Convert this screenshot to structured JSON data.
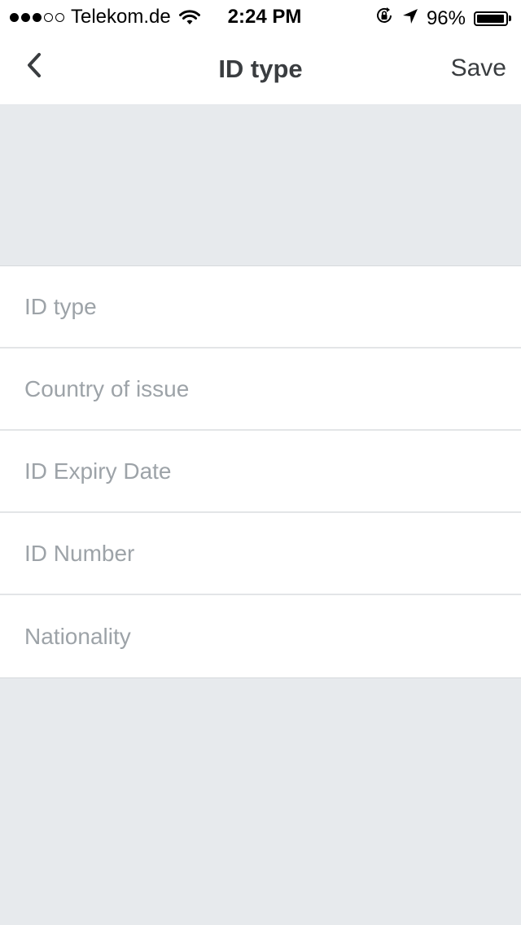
{
  "status_bar": {
    "carrier": "Telekom.de",
    "signal_bars_filled": 3,
    "signal_bars_total": 5,
    "time": "2:24 PM",
    "battery_percent": "96%",
    "icons": [
      "signal-icon",
      "wifi-icon",
      "orientation-lock-icon",
      "location-arrow-icon",
      "battery-icon"
    ]
  },
  "nav": {
    "title": "ID type",
    "save_label": "Save",
    "back_icon": "chevron-left-icon"
  },
  "form": {
    "fields": [
      {
        "placeholder": "ID type",
        "value": ""
      },
      {
        "placeholder": "Country of issue",
        "value": ""
      },
      {
        "placeholder": "ID Expiry Date",
        "value": ""
      },
      {
        "placeholder": "ID Number",
        "value": ""
      },
      {
        "placeholder": "Nationality",
        "value": ""
      }
    ]
  },
  "colors": {
    "background": "#e7eaed",
    "surface": "#ffffff",
    "text": "#3a3d40",
    "placeholder": "#9da3a8",
    "divider": "#e3e5e7"
  }
}
